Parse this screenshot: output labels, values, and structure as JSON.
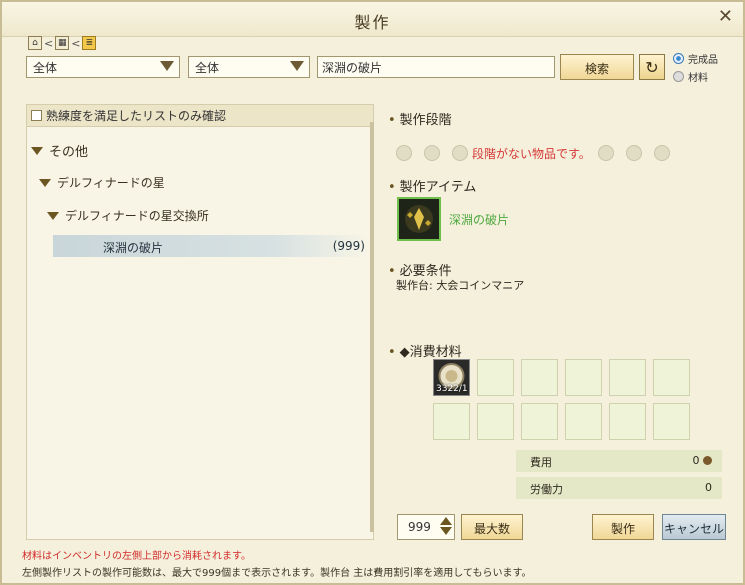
{
  "window": {
    "title": "製作",
    "close_symbol": "✕"
  },
  "breadcrumb": {
    "home_symbol": "⌂",
    "sep1": "<",
    "grid_symbol": "▦",
    "sep2": "<",
    "list_symbol": "≣"
  },
  "filters": {
    "category1": "全体",
    "category2": "全体",
    "search_value": "深淵の破片",
    "search_button": "検索"
  },
  "refresh_symbol": "↻",
  "view_mode": {
    "finished_label": "完成品",
    "material_label": "材料",
    "selected": "finished"
  },
  "list": {
    "proficiency_filter_label": "熟練度を満足したリストのみ確認",
    "tree": [
      {
        "label": "その他",
        "level": 0
      },
      {
        "label": "デルフィナードの星",
        "level": 1
      },
      {
        "label": "デルフィナードの星交換所",
        "level": 2
      }
    ],
    "leaf": {
      "label": "深淵の破片",
      "count": "(999)"
    }
  },
  "detail": {
    "craft_stage_title": "製作段階",
    "no_stage_text": "段階がない物品です。",
    "craft_item_title": "製作アイテム",
    "item_name": "深淵の破片",
    "requirement_title": "必要条件",
    "requirement_text": "製作台: 大会コインマニア",
    "materials_title": "◆消費材料",
    "material_count": "3322/1",
    "cost_label": "費用",
    "cost_value": "0",
    "labor_label": "労働力",
    "labor_value": "0"
  },
  "footer": {
    "quantity": "999",
    "max_button": "最大数",
    "craft_button": "製作",
    "cancel_button": "キャンセル",
    "notice_red": "材料はインベントリの左側上部から消耗されます。",
    "notice": "左側製作リストの製作可能数は、最大で999個まで表示されます。製作台 主は費用割引率を適用してもらいます。"
  },
  "colors": {
    "accent_gold": "#f0d796",
    "item_green": "#4fa840",
    "warning_red": "#d32a2a"
  }
}
